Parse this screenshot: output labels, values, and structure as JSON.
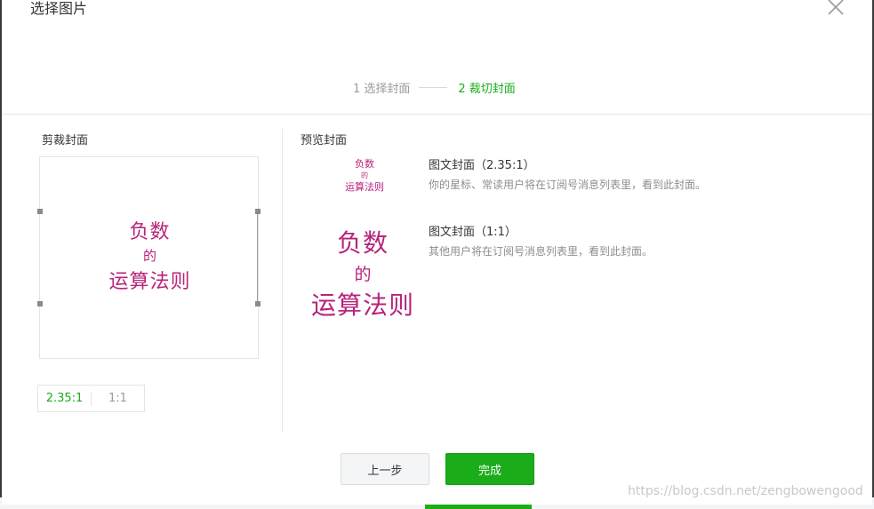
{
  "dialog": {
    "title": "选择图片",
    "close_icon": "close-icon"
  },
  "steps": {
    "step1": "1 选择封面",
    "step2": "2 裁切封面"
  },
  "crop": {
    "label": "剪裁封面",
    "image_text": {
      "line1": "负数",
      "line2": "的",
      "line3": "运算法则"
    },
    "ratios": [
      "2.35:1",
      "1:1"
    ],
    "active_ratio": "2.35:1"
  },
  "preview": {
    "label": "预览封面",
    "items": [
      {
        "title": "图文封面（2.35:1）",
        "desc": "你的星标、常读用户将在订阅号消息列表里，看到此封面。"
      },
      {
        "title": "图文封面（1:1）",
        "desc": "其他用户将在订阅号消息列表里，看到此封面。"
      }
    ]
  },
  "footer": {
    "prev_label": "上一步",
    "done_label": "完成"
  },
  "watermark": "https://blog.csdn.net/zengbowengood",
  "colors": {
    "accent": "#1aad19",
    "image_text": "#b8237a"
  }
}
